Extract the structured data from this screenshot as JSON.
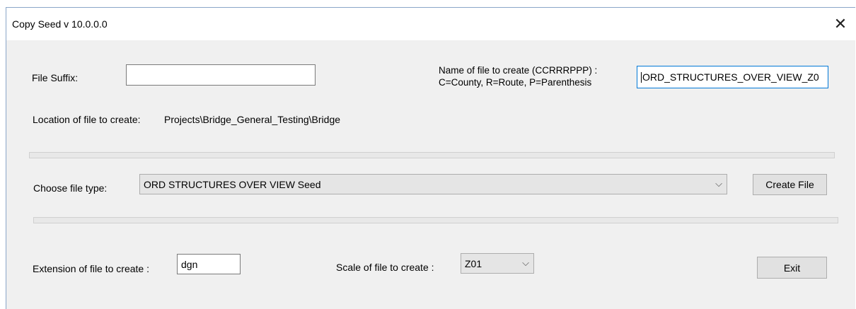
{
  "window": {
    "title": "Copy Seed v 10.0.0.0",
    "close_glyph": "✕"
  },
  "form": {
    "file_suffix_label": "File Suffix:",
    "file_suffix_value": "",
    "name_label_line1": "Name of file to create (CCRRRPPP) :",
    "name_label_line2": "C=County, R=Route, P=Parenthesis",
    "name_value": "ORD_STRUCTURES_OVER_VIEW_Z0",
    "location_label": "Location of file to create:",
    "location_value": "Projects\\Bridge_General_Testing\\Bridge",
    "file_type_label": "Choose file type:",
    "file_type_selected": "ORD STRUCTURES OVER VIEW Seed",
    "create_button": "Create File",
    "extension_label": "Extension of file to create :",
    "extension_value": "dgn",
    "scale_label": "Scale of file to create :",
    "scale_selected": "Z01",
    "exit_button": "Exit",
    "dropdown_glyph": "⌵"
  }
}
